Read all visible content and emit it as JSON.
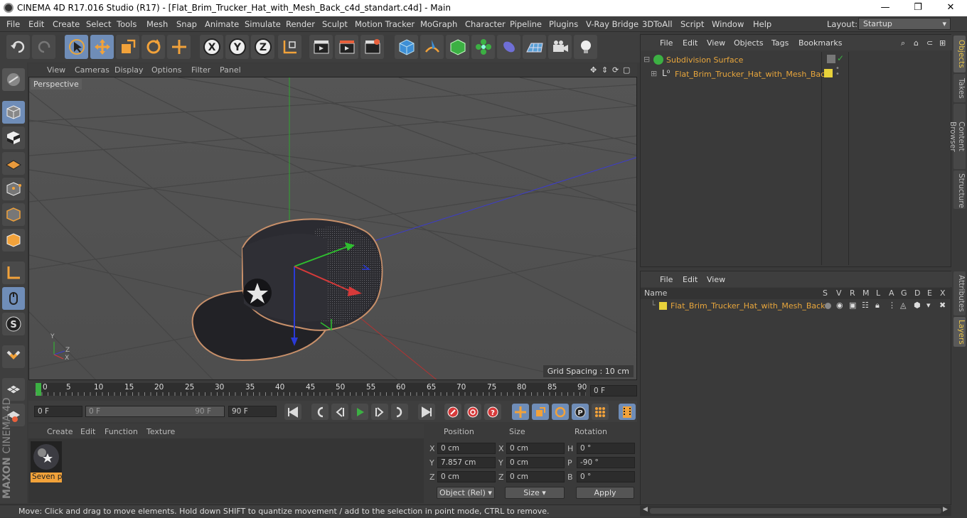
{
  "window": {
    "title": "CINEMA 4D R17.016 Studio (R17) - [Flat_Brim_Trucker_Hat_with_Mesh_Back_c4d_standart.c4d] - Main",
    "minimize": "—",
    "maximize": "❐",
    "close": "✕"
  },
  "menubar": {
    "items": [
      "File",
      "Edit",
      "Create",
      "Select",
      "Tools",
      "Mesh",
      "Snap",
      "Animate",
      "Simulate",
      "Render",
      "Sculpt",
      "Motion Tracker",
      "MoGraph",
      "Character",
      "Pipeline",
      "Plugins",
      "V-Ray Bridge",
      "3DToAll",
      "Script",
      "Window",
      "Help"
    ],
    "layout_label": "Layout:",
    "layout_value": "Startup"
  },
  "viewport": {
    "menu": [
      "View",
      "Cameras",
      "Display",
      "Options",
      "Filter",
      "Panel"
    ],
    "camera_label": "Perspective",
    "grid_spacing": "Grid Spacing : 10 cm",
    "axis_x": "X",
    "axis_y": "Y",
    "axis_z": "Z"
  },
  "timeline": {
    "ticks": [
      "0",
      "5",
      "10",
      "15",
      "20",
      "25",
      "30",
      "35",
      "40",
      "45",
      "50",
      "55",
      "60",
      "65",
      "70",
      "75",
      "80",
      "85",
      "90"
    ],
    "current_frame": "0 F"
  },
  "transport": {
    "start_field": "0 F",
    "range_start": "0 F",
    "range_end": "90 F",
    "end_field": "90 F"
  },
  "materials": {
    "menu": [
      "Create",
      "Edit",
      "Function",
      "Texture"
    ],
    "items": [
      {
        "name": "Seven p"
      }
    ]
  },
  "coordinates": {
    "headers": {
      "position": "Position",
      "size": "Size",
      "rotation": "Rotation"
    },
    "rows": [
      {
        "axis": "X",
        "pos": "0 cm",
        "size_axis": "X",
        "size": "0 cm",
        "rot_axis": "H",
        "rot": "0 °"
      },
      {
        "axis": "Y",
        "pos": "7.857 cm",
        "size_axis": "Y",
        "size": "0 cm",
        "rot_axis": "P",
        "rot": "-90 °"
      },
      {
        "axis": "Z",
        "pos": "0 cm",
        "size_axis": "Z",
        "size": "0 cm",
        "rot_axis": "B",
        "rot": "0 °"
      }
    ],
    "mode_select": "Object (Rel)",
    "size_select": "Size",
    "apply": "Apply"
  },
  "status": {
    "text": "Move: Click and drag to move elements. Hold down SHIFT to quantize movement / add to the selection in point mode, CTRL to remove."
  },
  "objects_panel": {
    "menu": [
      "File",
      "Edit",
      "View",
      "Objects",
      "Tags",
      "Bookmarks"
    ],
    "tree": [
      {
        "name": "Subdivision Surface"
      },
      {
        "name": "Flat_Brim_Trucker_Hat_with_Mesh_Back"
      }
    ]
  },
  "layers_panel": {
    "menu": [
      "File",
      "Edit",
      "View"
    ],
    "columns": [
      "Name",
      "S",
      "V",
      "R",
      "M",
      "L",
      "A",
      "G",
      "D",
      "E",
      "X"
    ],
    "rows": [
      {
        "name": "Flat_Brim_Trucker_Hat_with_Mesh_Back"
      }
    ]
  },
  "side_tabs": [
    "Objects",
    "Takes",
    "Content Browser",
    "Structure",
    "Attributes",
    "Layers"
  ],
  "brand": {
    "maxon": "MAXON",
    "product": "CINEMA 4D"
  },
  "colors": {
    "accent_blue": "#6f8db8",
    "layer_yellow": "#e8d23a",
    "label_orange": "#e8a63c"
  }
}
